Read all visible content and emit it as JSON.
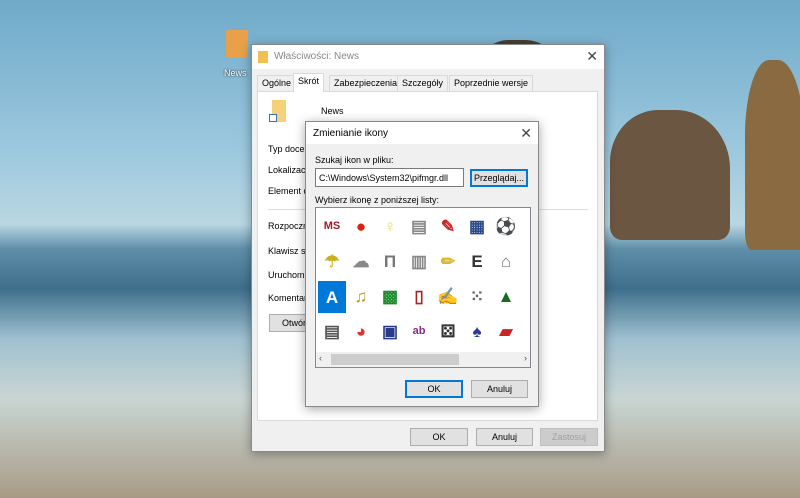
{
  "desktop": {
    "icon_label": "News"
  },
  "properties": {
    "title": "Właściwości: News",
    "tabs": [
      "Ogólne",
      "Skrót",
      "Zabezpieczenia",
      "Szczegóły",
      "Poprzednie wersje"
    ],
    "active_tab": "Skrót",
    "name": "News",
    "labels": [
      "Typ docel",
      "Lokalizacj",
      "Element d",
      "Rozpoczn",
      "Klawisz sk",
      "Uruchom:",
      "Komentarz"
    ],
    "open_button": "Otwórz",
    "ok": "OK",
    "cancel": "Anuluj",
    "apply": "Zastosuj"
  },
  "change_icon": {
    "title": "Zmienianie ikony",
    "file_label": "Szukaj ikon w pliku:",
    "file_value": "C:\\Windows\\System32\\pifmgr.dll",
    "browse": "Przeglądaj...",
    "list_label": "Wybierz ikonę z poniższej listy:",
    "icons": [
      [
        "ms-dos-icon",
        "apple-icon",
        "lightbulb-icon",
        "keyboard-icon",
        "paint-icon",
        "window-icon",
        "soccer-ball-icon",
        "partial-icon"
      ],
      [
        "umbrella-icon",
        "storm-cloud-icon",
        "column-icon",
        "cabinet-icon",
        "pencil-icon",
        "eye-chart-icon",
        "bag-icon",
        "partial-icon"
      ],
      [
        "blocks-icon",
        "tuba-icon",
        "circuit-icon",
        "book-icon",
        "notepad-icon",
        "dominoes-icon",
        "party-icon",
        "partial-icon"
      ],
      [
        "newspaper-icon",
        "beach-ball-icon",
        "computer-icon",
        "document-icon",
        "dice-icon",
        "cards-icon",
        "race-car-icon",
        "partial-icon"
      ]
    ],
    "selected_icon": "blocks-icon",
    "ok": "OK",
    "cancel": "Anuluj"
  },
  "colors": {
    "accent": "#0078d7",
    "selection": "#0078d7"
  }
}
